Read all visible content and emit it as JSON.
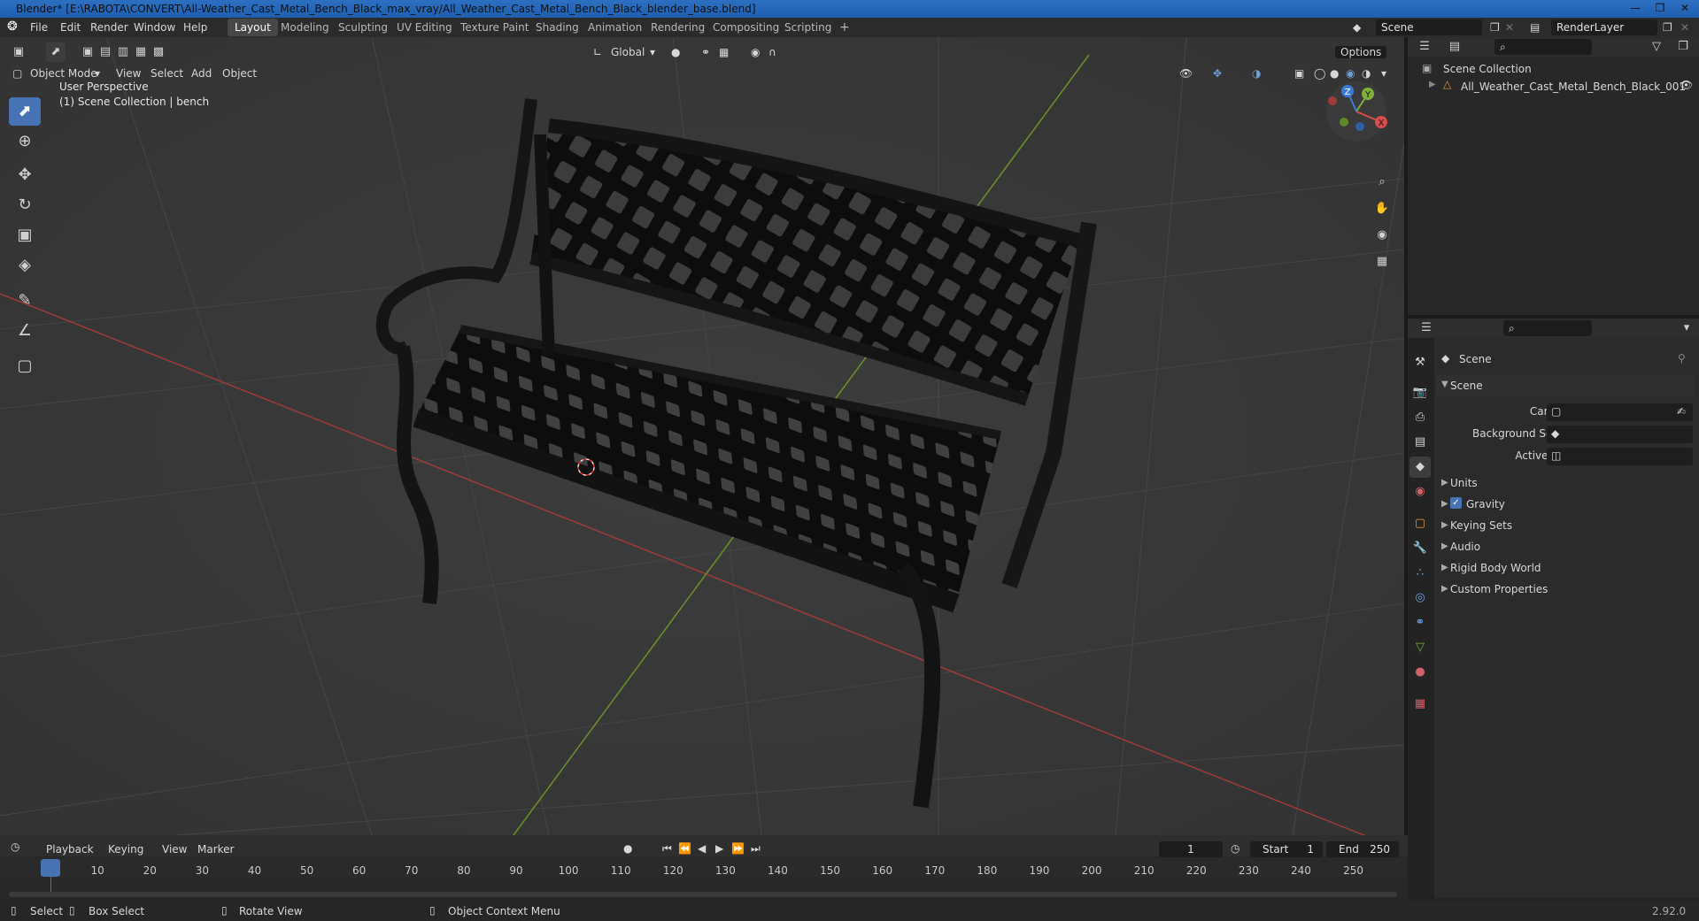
{
  "window": {
    "title": "Blender* [E:\\RABOTA\\CONVERT\\All-Weather_Cast_Metal_Bench_Black_max_vray/All_Weather_Cast_Metal_Bench_Black_blender_base.blend]"
  },
  "menu": [
    "File",
    "Edit",
    "Render",
    "Window",
    "Help"
  ],
  "workspaces": [
    {
      "label": "Layout",
      "active": true
    },
    {
      "label": "Modeling"
    },
    {
      "label": "Sculpting"
    },
    {
      "label": "UV Editing"
    },
    {
      "label": "Texture Paint"
    },
    {
      "label": "Shading"
    },
    {
      "label": "Animation"
    },
    {
      "label": "Rendering"
    },
    {
      "label": "Compositing"
    },
    {
      "label": "Scripting"
    }
  ],
  "top_right": {
    "scene": "Scene",
    "view_layer": "RenderLayer"
  },
  "viewport_header": {
    "mode": "Object Mode",
    "menus": [
      "View",
      "Select",
      "Add",
      "Object"
    ],
    "orientation": "Global",
    "options": "Options"
  },
  "viewport": {
    "perspective_label": "User Perspective",
    "collection_label": "(1) Scene Collection | bench",
    "gizmo_axes": [
      "X",
      "Y",
      "Z"
    ]
  },
  "outliner": {
    "root": "Scene Collection",
    "items": [
      "All_Weather_Cast_Metal_Bench_Black_001"
    ]
  },
  "properties": {
    "context": "Scene",
    "panel_title": "Scene",
    "fields": [
      {
        "label": "Camera"
      },
      {
        "label": "Background Scene"
      },
      {
        "label": "Active Clip"
      }
    ],
    "subpanels": [
      {
        "label": "Units"
      },
      {
        "label": "Gravity",
        "checked": true
      },
      {
        "label": "Keying Sets"
      },
      {
        "label": "Audio"
      },
      {
        "label": "Rigid Body World"
      },
      {
        "label": "Custom Properties"
      }
    ]
  },
  "timeline": {
    "menus": [
      "Playback",
      "Keying",
      "View",
      "Marker"
    ],
    "current_frame": "1",
    "start_label": "Start",
    "start": "1",
    "end_label": "End",
    "end": "250",
    "ticks": [
      "1",
      "10",
      "20",
      "30",
      "40",
      "50",
      "60",
      "70",
      "80",
      "90",
      "100",
      "110",
      "120",
      "130",
      "140",
      "150",
      "160",
      "170",
      "180",
      "190",
      "200",
      "210",
      "220",
      "230",
      "240",
      "250"
    ]
  },
  "statusbar": {
    "items": [
      "Select",
      "Box Select",
      "Rotate View",
      "Object Context Menu"
    ],
    "version": "2.92.0"
  },
  "colors": {
    "accent": "#4772b3",
    "x_axis": "#d94c4c",
    "y_axis": "#7fb13a",
    "z_axis": "#3a7bd5"
  }
}
